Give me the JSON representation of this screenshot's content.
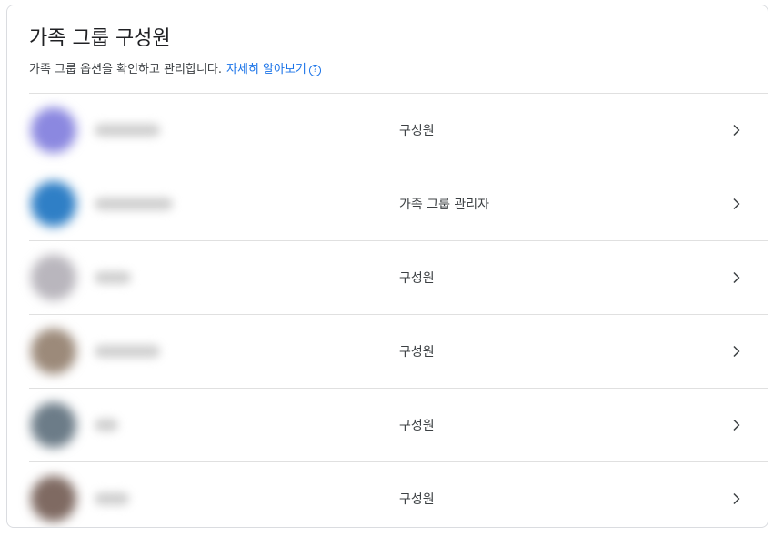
{
  "header": {
    "title": "가족 그룹 구성원",
    "subtitle": "가족 그룹 옵션을 확인하고 관리합니다.",
    "learn_more": "자세히 알아보기",
    "help_glyph": "?"
  },
  "members": [
    {
      "role": "구성원",
      "avatar_color": "#8b88e0"
    },
    {
      "role": "가족 그룹 관리자",
      "avatar_color": "#2f7fc6"
    },
    {
      "role": "구성원",
      "avatar_color": "#b9b6bd"
    },
    {
      "role": "구성원",
      "avatar_color": "#9c8a7a"
    },
    {
      "role": "구성원",
      "avatar_color": "#6c7c88"
    },
    {
      "role": "구성원",
      "avatar_color": "#7f6a62"
    }
  ],
  "icons": {
    "chevron": "chevron-right-icon",
    "help": "help-circle-icon"
  }
}
